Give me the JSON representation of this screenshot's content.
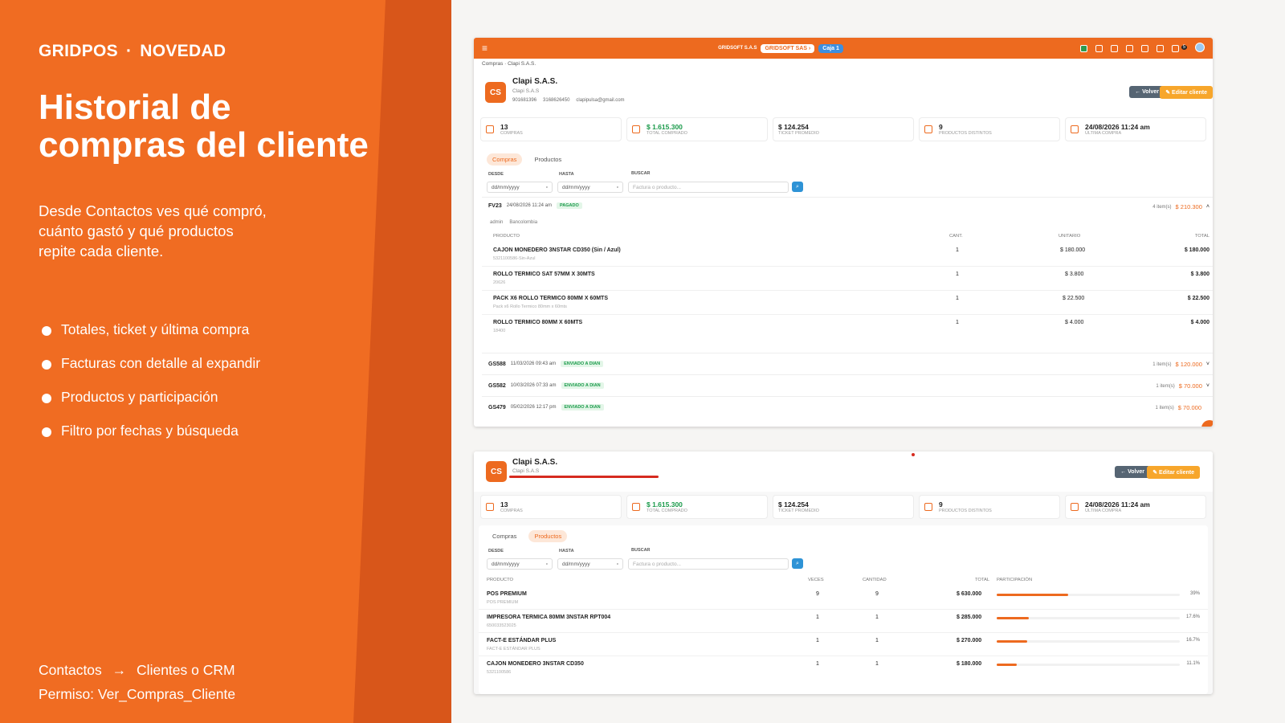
{
  "slide": {
    "kicker_brand": "GRIDPOS",
    "kicker_sep": "·",
    "kicker_tag": "NOVEDAD",
    "title_line1": "Historial de",
    "title_line2": "compras del cliente",
    "desc_line1": "Desde Contactos ves qué compró,",
    "desc_line2": "cuánto gastó y qué productos",
    "desc_line3": "repite cada cliente.",
    "bullets": [
      "Totales, ticket y última compra",
      "Facturas con detalle al expandir",
      "Productos y participación",
      "Filtro por fechas y búsqueda"
    ],
    "nav_from": "Contactos",
    "nav_arrow": "→",
    "nav_to": "Clientes o CRM",
    "permission": "Permiso: Ver_Compras_Cliente"
  },
  "app": {
    "top_company": "GRIDSOFT S.A.S",
    "top_company_chip": "GRIDSOFT SAS ›",
    "top_caja": "Caja 1",
    "notif_count": "5",
    "breadcrumb": "Compras · Clapi S.A.S.",
    "avatar": "CS",
    "client_name": "Clapi S.A.S.",
    "client_sub": "Clapi S.A.S",
    "client_id": "901681396",
    "client_phone": "3168626450",
    "client_email": "clapipulsa@gmail.com",
    "btn_back": "← Volver",
    "btn_edit": "✎ Editar cliente",
    "stats": [
      {
        "value": "13",
        "label": "COMPRAS",
        "green": false
      },
      {
        "value": "$ 1.615.300",
        "label": "TOTAL COMPRADO",
        "green": true
      },
      {
        "value": "$ 124.254",
        "label": "TICKET PROMEDIO",
        "green": false
      },
      {
        "value": "9",
        "label": "PRODUCTOS DISTINTOS",
        "green": false
      },
      {
        "value": "24/08/2026 11:24 am",
        "label": "ÚLTIMA COMPRA",
        "green": false
      }
    ],
    "tab_compras": "Compras",
    "tab_productos": "Productos",
    "filter_desde": "DESDE",
    "filter_hasta": "HASTA",
    "filter_buscar": "BUSCAR",
    "date_placeholder": "dd/mm/yyyy",
    "search_placeholder": "Factura o producto..."
  },
  "invoice_main": {
    "number": "FV23",
    "date": "24/08/2026 11:24 am",
    "status": "PAGADO",
    "items": "4 item(s)",
    "total": "$ 210.300",
    "user": "admin",
    "bank": "Bancolombia",
    "headers": {
      "product": "PRODUCTO",
      "qty": "CANT.",
      "unit": "UNITARIO",
      "total": "TOTAL"
    },
    "lines": [
      {
        "name": "CAJON MONEDERO 3NSTAR CD350 (Sin / Azul)",
        "sku": "5321100586-Sin-Azul",
        "qty": "1",
        "unit": "$ 180.000",
        "total": "$ 180.000"
      },
      {
        "name": "ROLLO TERMICO SAT 57MM X 30MTS",
        "sku": "20626",
        "qty": "1",
        "unit": "$ 3.800",
        "total": "$ 3.800"
      },
      {
        "name": "PACK X6 ROLLO TERMICO 80MM X 60MTS",
        "sku": "Pack x6 Rollo Termico 80mm x 60mts",
        "qty": "1",
        "unit": "$ 22.500",
        "total": "$ 22.500"
      },
      {
        "name": "ROLLO TERMICO 80MM X 60MTS",
        "sku": "18400",
        "qty": "1",
        "unit": "$ 4.000",
        "total": "$ 4.000"
      }
    ]
  },
  "other_invoices": [
    {
      "number": "GS588",
      "date": "11/03/2026 09:43 am",
      "status": "ENVIADO A DIAN",
      "items": "1 item(s)",
      "total": "$ 120.000"
    },
    {
      "number": "GS582",
      "date": "10/03/2026 07:33 am",
      "status": "ENVIADO A DIAN",
      "items": "1 item(s)",
      "total": "$ 70.000"
    },
    {
      "number": "GS479",
      "date": "05/02/2026 12:17 pm",
      "status": "ENVIADO A DIAN",
      "items": "1 item(s)",
      "total": "$ 70.000"
    }
  ],
  "products": {
    "headers": {
      "product": "PRODUCTO",
      "times": "VECES",
      "qty": "CANTIDAD",
      "total": "TOTAL",
      "share": "PARTICIPACIÓN"
    },
    "rows": [
      {
        "name": "POS PREMIUM",
        "sku": "POS PREMIUM",
        "times": "9",
        "qty": "9",
        "total": "$ 630.000",
        "share": "39%",
        "pct": 39
      },
      {
        "name": "IMPRESORA TERMICA 80MM 3NSTAR RPT004",
        "sku": "650033523025",
        "times": "1",
        "qty": "1",
        "total": "$ 285.000",
        "share": "17.6%",
        "pct": 17.6
      },
      {
        "name": "FACT-E ESTÁNDAR PLUS",
        "sku": "FACT-E ESTÁNDAR PLUS",
        "times": "1",
        "qty": "1",
        "total": "$ 270.000",
        "share": "16.7%",
        "pct": 16.7
      },
      {
        "name": "CAJON MONEDERO 3NSTAR CD350",
        "sku": "5321100586",
        "times": "1",
        "qty": "1",
        "total": "$ 180.000",
        "share": "11.1%",
        "pct": 11.1
      }
    ]
  }
}
